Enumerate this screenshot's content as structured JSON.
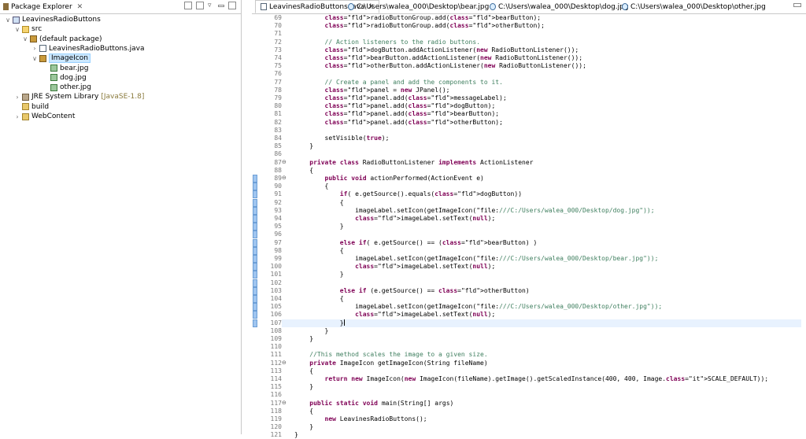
{
  "package_explorer": {
    "title": "Package Explorer",
    "close": "✕",
    "tree": [
      {
        "label": "LeavinesRadioButtons",
        "icon": "project-icon",
        "twisty": "∨"
      },
      {
        "label": "src",
        "icon": "source-folder-icon",
        "twisty": "∨"
      },
      {
        "label": "(default package)",
        "icon": "package-icon",
        "twisty": "∨"
      },
      {
        "label": "LeavinesRadioButtons.java",
        "icon": "java-file-icon",
        "twisty": "›"
      },
      {
        "label": "ImageIcon",
        "icon": "package-icon",
        "twisty": "∨",
        "selected": true
      },
      {
        "label": "bear.jpg",
        "icon": "image-icon"
      },
      {
        "label": "dog.jpg",
        "icon": "image-icon"
      },
      {
        "label": "other.jpg",
        "icon": "image-icon"
      },
      {
        "label": "JRE System Library",
        "suffix": "[JavaSE-1.8]",
        "icon": "library-icon",
        "twisty": "›"
      },
      {
        "label": "build",
        "icon": "folder-icon"
      },
      {
        "label": "WebContent",
        "icon": "folder-icon",
        "twisty": "›"
      }
    ]
  },
  "editor": {
    "tabs": [
      {
        "label": "LeavinesRadioButtons.java",
        "close": "✕",
        "active": true
      },
      {
        "label": "C:\\Users\\walea_000\\Desktop\\bear.jpg"
      },
      {
        "label": "C:\\Users\\walea_000\\Desktop\\dog.jpg"
      },
      {
        "label": "C:\\Users\\walea_000\\Desktop\\other.jpg"
      }
    ],
    "highlighted_line": "107",
    "lines": [
      {
        "n": "69",
        "t": "        radioButtonGroup.add(bearButton);"
      },
      {
        "n": "70",
        "t": "        radioButtonGroup.add(otherButton);"
      },
      {
        "n": "71",
        "t": ""
      },
      {
        "n": "72",
        "t": "        // Action listeners to the radio buttons."
      },
      {
        "n": "73",
        "t": "        dogButton.addActionListener(new RadioButtonListener());"
      },
      {
        "n": "74",
        "t": "        bearButton.addActionListener(new RadioButtonListener());"
      },
      {
        "n": "75",
        "t": "        otherButton.addActionListener(new RadioButtonListener());"
      },
      {
        "n": "76",
        "t": ""
      },
      {
        "n": "77",
        "t": "        // Create a panel and add the components to it."
      },
      {
        "n": "78",
        "t": "        panel = new JPanel();"
      },
      {
        "n": "79",
        "t": "        panel.add(messageLabel);"
      },
      {
        "n": "80",
        "t": "        panel.add(dogButton);"
      },
      {
        "n": "81",
        "t": "        panel.add(bearButton);"
      },
      {
        "n": "82",
        "t": "        panel.add(otherButton);"
      },
      {
        "n": "83",
        "t": ""
      },
      {
        "n": "84",
        "t": "        setVisible(true);"
      },
      {
        "n": "85",
        "t": "    }"
      },
      {
        "n": "86",
        "t": ""
      },
      {
        "n": "87",
        "t": "    private class RadioButtonListener implements ActionListener"
      },
      {
        "n": "88",
        "t": "    {"
      },
      {
        "n": "89",
        "t": "        public void actionPerformed(ActionEvent e)"
      },
      {
        "n": "90",
        "t": "        {"
      },
      {
        "n": "91",
        "t": "            if( e.getSource().equals(dogButton))"
      },
      {
        "n": "92",
        "t": "            {"
      },
      {
        "n": "93",
        "t": "                imageLabel.setIcon(getImageIcon(\"file:///C:/Users/walea_000/Desktop/dog.jpg\"));"
      },
      {
        "n": "94",
        "t": "                imageLabel.setText(null);"
      },
      {
        "n": "95",
        "t": "            }"
      },
      {
        "n": "96",
        "t": ""
      },
      {
        "n": "97",
        "t": "            else if( e.getSource() == (bearButton) )"
      },
      {
        "n": "98",
        "t": "            {"
      },
      {
        "n": "99",
        "t": "                imageLabel.setIcon(getImageIcon(\"file:///C:/Users/walea_000/Desktop/bear.jpg\"));"
      },
      {
        "n": "100",
        "t": "                imageLabel.setText(null);"
      },
      {
        "n": "101",
        "t": "            }"
      },
      {
        "n": "102",
        "t": ""
      },
      {
        "n": "103",
        "t": "            else if (e.getSource() == otherButton)"
      },
      {
        "n": "104",
        "t": "            {"
      },
      {
        "n": "105",
        "t": "                imageLabel.setIcon(getImageIcon(\"file:///C:/Users/walea_000/Desktop/other.jpg\"));"
      },
      {
        "n": "106",
        "t": "                imageLabel.setText(null);"
      },
      {
        "n": "107",
        "t": "            }"
      },
      {
        "n": "108",
        "t": "        }"
      },
      {
        "n": "109",
        "t": "    }"
      },
      {
        "n": "110",
        "t": ""
      },
      {
        "n": "111",
        "t": "    //This method scales the image to a given size."
      },
      {
        "n": "112",
        "t": "    private ImageIcon getImageIcon(String fileName)"
      },
      {
        "n": "113",
        "t": "    {"
      },
      {
        "n": "114",
        "t": "        return new ImageIcon(new ImageIcon(fileName).getImage().getScaledInstance(400, 400, Image.SCALE_DEFAULT));"
      },
      {
        "n": "115",
        "t": "    }"
      },
      {
        "n": "116",
        "t": ""
      },
      {
        "n": "117",
        "t": "    public static void main(String[] args)"
      },
      {
        "n": "118",
        "t": "    {"
      },
      {
        "n": "119",
        "t": "        new LeavinesRadioButtons();"
      },
      {
        "n": "120",
        "t": "    }"
      },
      {
        "n": "121",
        "t": "}"
      }
    ]
  }
}
